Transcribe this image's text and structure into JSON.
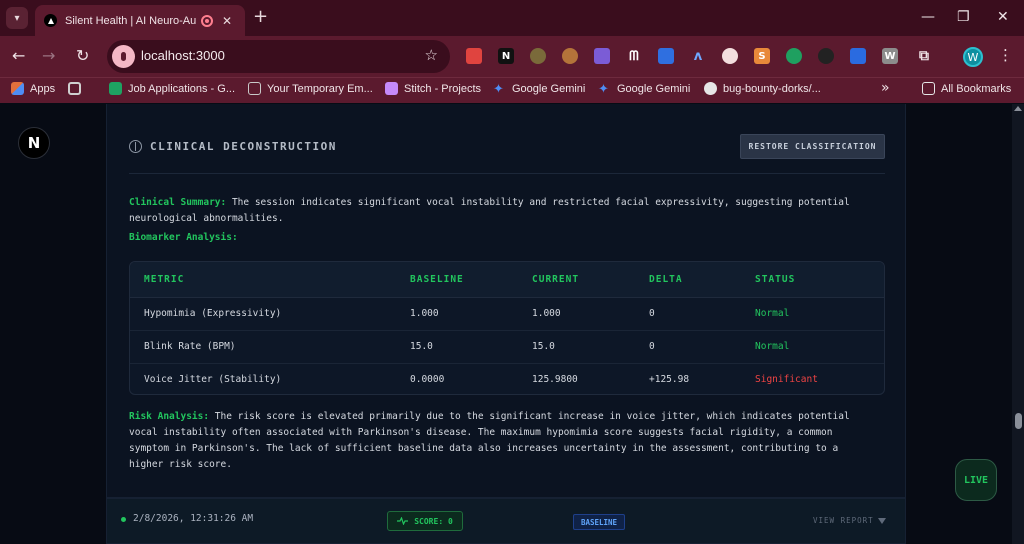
{
  "browser": {
    "tab_title": "Silent Health | AI Neuro-Au",
    "tab_close": "✕",
    "new_tab": "+",
    "url": "localhost:3000",
    "window": {
      "minimize": "—",
      "restore": "❐",
      "close": "✕"
    },
    "extensions": [
      "N",
      "S",
      "W"
    ],
    "avatar_letter": "W",
    "bookmarks": [
      {
        "label": "Apps",
        "color": "#e36f3c"
      },
      {
        "label": "",
        "color": "#cfcfcf"
      },
      {
        "label": "Job Applications - G...",
        "color": "#1ea362"
      },
      {
        "label": "Your Temporary Em...",
        "color": "#8a8a8a"
      },
      {
        "label": "Stitch - Projects",
        "color": "#c58af9"
      },
      {
        "label": "Google Gemini",
        "color": "#4f8df5"
      },
      {
        "label": "Google Gemini",
        "color": "#4f8df5"
      },
      {
        "label": "bug-bounty-dorks/...",
        "color": "#e6e6e6"
      }
    ],
    "more_bookmarks": "»",
    "all_bookmarks": "All Bookmarks"
  },
  "app": {
    "logo_letter": "N",
    "live_label": "LIVE"
  },
  "panel": {
    "title": "CLINICAL DECONSTRUCTION",
    "restore_button": "RESTORE CLASSIFICATION",
    "summary_label": "Clinical Summary:",
    "summary_line1": " The session indicates significant vocal instability and restricted facial expressivity, suggesting potential",
    "summary_line2": "neurological abnormalities.",
    "biomarker_label": "Biomarker Analysis:",
    "table": {
      "headers": [
        "METRIC",
        "BASELINE",
        "CURRENT",
        "DELTA",
        "STATUS"
      ],
      "rows": [
        {
          "metric": "Hypomimia (Expressivity)",
          "baseline": "1.000",
          "current": "1.000",
          "delta": "0",
          "status": "Normal"
        },
        {
          "metric": "Blink Rate (BPM)",
          "baseline": "15.0",
          "current": "15.0",
          "delta": "0",
          "status": "Normal"
        },
        {
          "metric": "Voice Jitter (Stability)",
          "baseline": "0.0000",
          "current": "125.9800",
          "delta": "+125.98",
          "status": "Significant"
        }
      ]
    },
    "risk_label": "Risk Analysis:",
    "risk_line1": " The risk score is elevated primarily due to the significant increase in voice jitter, which indicates potential",
    "risk_line2": "vocal instability often associated with Parkinson's disease. The maximum hypomimia score suggests facial rigidity, a common",
    "risk_line3": "symptom in Parkinson's. The lack of sufficient baseline data also increases uncertainty in the assessment, contributing to a",
    "risk_line4": "higher risk score."
  },
  "session": {
    "timestamp": "2/8/2026, 12:31:26 AM",
    "score": "SCORE: 0",
    "badge": "BASELINE",
    "view_report": "VIEW REPORT"
  },
  "colors": {
    "accent_green": "#22c55e",
    "significant_red": "#ef4444",
    "baseline_blue": "#60a5fa",
    "chrome": "#5b1a2e"
  }
}
